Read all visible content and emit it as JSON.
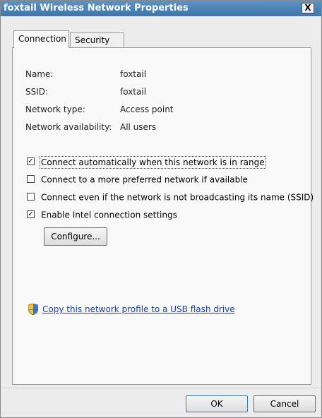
{
  "window": {
    "title": "foxtail Wireless Network Properties",
    "close_glyph": "X"
  },
  "tabs": [
    {
      "label": "Connection",
      "active": true
    },
    {
      "label": "Security",
      "active": false
    }
  ],
  "info": {
    "name_label": "Name:",
    "name_value": "foxtail",
    "ssid_label": "SSID:",
    "ssid_value": "foxtail",
    "type_label": "Network type:",
    "type_value": "Access point",
    "avail_label": "Network availability:",
    "avail_value": "All users"
  },
  "options": [
    {
      "label": "Connect automatically when this network is in range",
      "checked": true
    },
    {
      "label": "Connect to a more preferred network if available",
      "checked": false
    },
    {
      "label": "Connect even if the network is not broadcasting its name (SSID)",
      "checked": false
    },
    {
      "label": "Enable Intel connection settings",
      "checked": true
    }
  ],
  "configure_label": "Configure...",
  "link": {
    "text": "Copy this network profile to a USB flash drive",
    "icon": "shield-icon"
  },
  "buttons": {
    "ok": "OK",
    "cancel": "Cancel"
  },
  "colors": {
    "title_bar": "#3d75ad",
    "link": "#1a3dbf"
  }
}
